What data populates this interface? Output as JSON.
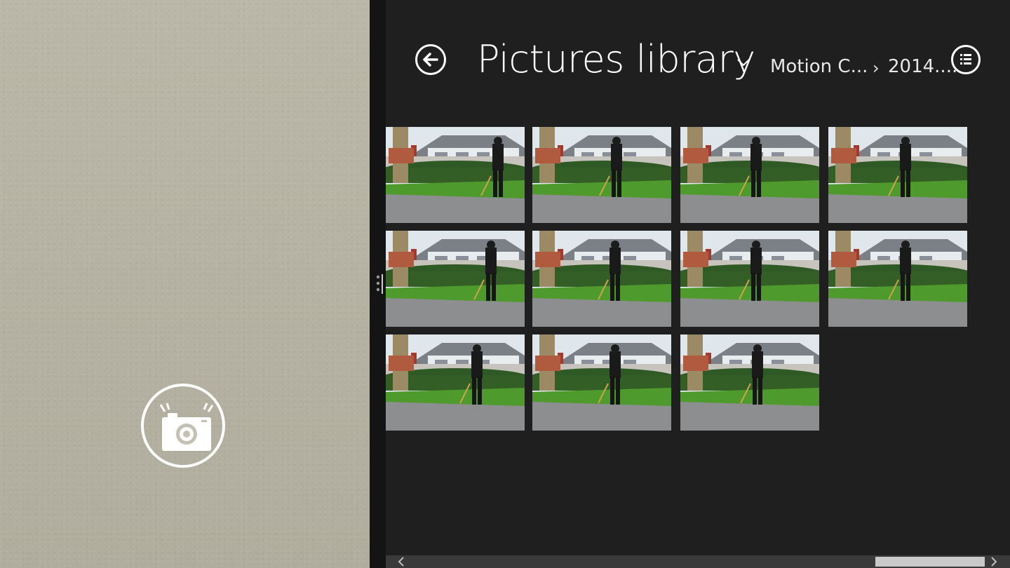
{
  "header": {
    "title": "Pictures library",
    "breadcrumbs": [
      "Motion C...",
      "2014...."
    ],
    "breadcrumb_separator": "›"
  },
  "icons": {
    "back": "back-arrow-icon",
    "title_dropdown": "chevron-down-icon",
    "view_toggle": "list-view-icon",
    "shutter": "camera-icon",
    "splitter": "splitter-grip-icon",
    "scroll_left": "chevron-left-icon",
    "scroll_right": "chevron-right-icon"
  },
  "gallery": {
    "rows": 3,
    "columns": 4,
    "thumbnail_count": 11
  },
  "colors": {
    "pane_background": "#1f1f1f",
    "camera_background": "#b9b5a6",
    "accent": "#ffffff"
  }
}
